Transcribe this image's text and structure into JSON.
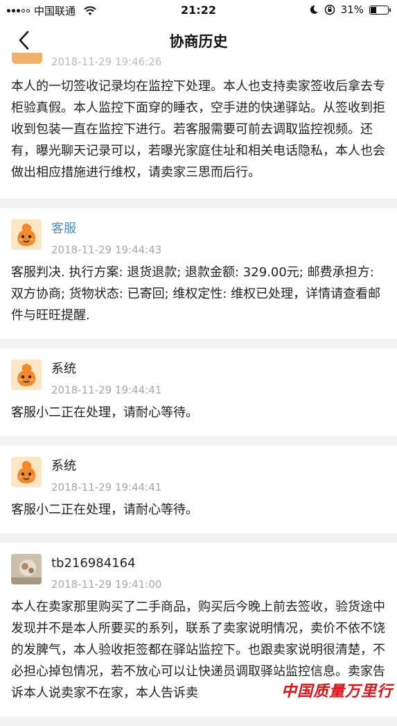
{
  "status_bar": {
    "carrier": "中国联通",
    "time": "21:22",
    "battery_text": "31%",
    "battery_level": 0.31,
    "icons": [
      "signal-icon",
      "wifi-icon",
      "moon-icon",
      "rotation-lock-icon",
      "battery-icon"
    ]
  },
  "nav": {
    "title": "协商历史",
    "back_icon": "chevron-left-icon"
  },
  "records": [
    {
      "time": "2018-11-29 19:46:26",
      "text": "本人的一切签收记录均在监控下处理。本人也支持卖家签收后拿去专柜验真假。本人监控下面穿的睡衣，空手进的快递驿站。从签收到拒收到包装一直在监控下进行。若客服需要可前去调取监控视频。还有，曝光聊天记录可以，若曝光家庭住址和相关电话隐私，本人也会做出相应措施进行维权，请卖家三思而后行。"
    },
    {
      "name": "客服",
      "time": "2018-11-29 19:44:43",
      "text": "客服判决. 执行方案: 退货退款; 退款金额: 329.00元; 邮费承担方: 双方协商; 货物状态: 已寄回; 维权定性: 维权已处理，详情请查看邮件与旺旺提醒."
    },
    {
      "name": "系统",
      "time": "2018-11-29 19:44:41",
      "text": "客服小二正在处理，请耐心等待。"
    },
    {
      "name": "系统",
      "time": "2018-11-29 19:44:41",
      "text": "客服小二正在处理，请耐心等待。"
    },
    {
      "name": "tb216984164",
      "time": "2018-11-29 19:41:00",
      "text": "本人在卖家那里购买了二手商品，购买后今晚上前去签收，验货途中发现并不是本人所要买的系列，联系了卖家说明情况，卖价不依不饶的发脾气，本人验收拒签都在驿站监控下。也跟卖家说明很清楚，不必担心掉包情况，若不放心可以让快递员调取驿站监控信息。卖家告诉本人说卖家不在家，本人告诉卖"
    }
  ],
  "watermark": "中国质量万里行",
  "colors": {
    "link": "#4a90c8",
    "timestamp": "#a8a8a8",
    "background": "#f2f2f2",
    "watermark": "#d61518"
  }
}
